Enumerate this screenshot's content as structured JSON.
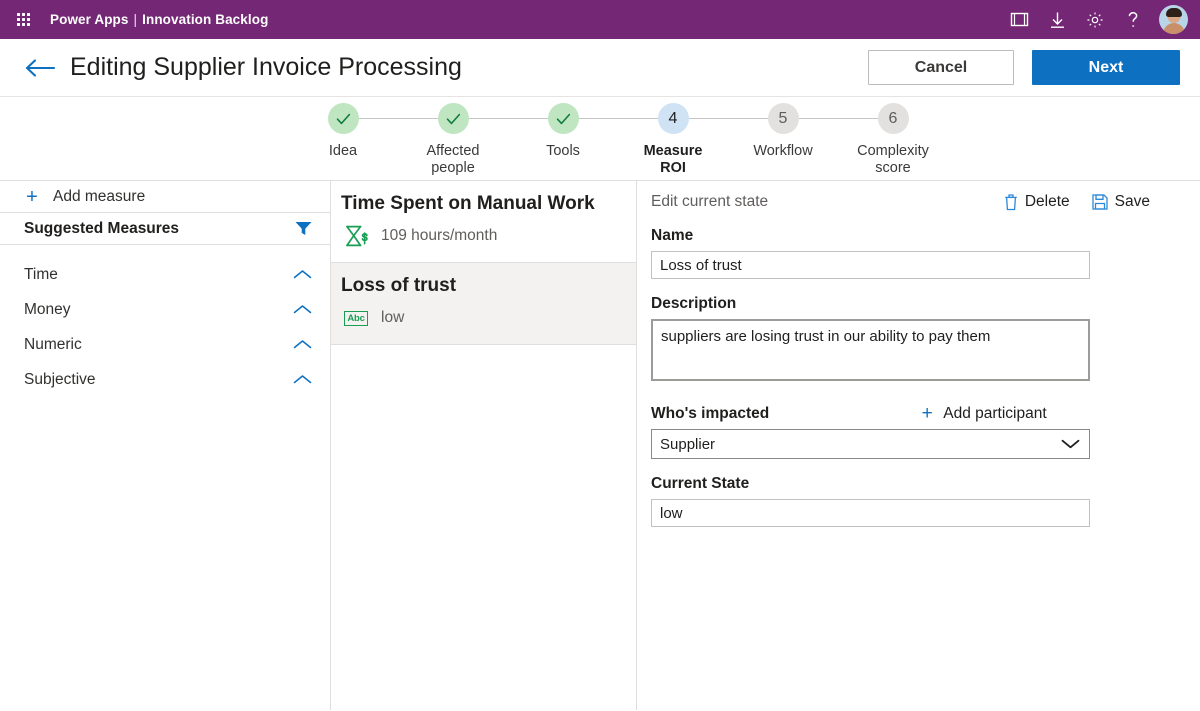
{
  "topbar": {
    "waffle_icon": "app-launcher-icon",
    "brand": "Power Apps",
    "separator": "|",
    "app_name": "Innovation Backlog",
    "icons": [
      {
        "name": "screen-frame-icon",
        "label": "Display options"
      },
      {
        "name": "download-icon",
        "label": "Download"
      },
      {
        "name": "gear-icon",
        "label": "Settings"
      },
      {
        "name": "help-icon",
        "label": "Help"
      }
    ],
    "avatar_name": "user-avatar"
  },
  "header": {
    "back_icon": "back-arrow-icon",
    "title": "Editing Supplier Invoice Processing",
    "cancel_label": "Cancel",
    "next_label": "Next",
    "accent_blue": "#0e70c0"
  },
  "stepper": {
    "steps": [
      {
        "number": "1",
        "label": "Idea",
        "state": "done",
        "mark": "✓"
      },
      {
        "number": "2",
        "label": "Affected\npeople",
        "state": "done",
        "mark": "✓"
      },
      {
        "number": "3",
        "label": "Tools",
        "state": "done",
        "mark": "✓"
      },
      {
        "number": "4",
        "label": "Measure\nROI",
        "state": "active",
        "mark": "4"
      },
      {
        "number": "5",
        "label": "Workflow",
        "state": "todo",
        "mark": "5"
      },
      {
        "number": "6",
        "label": "Complexity\nscore",
        "state": "todo",
        "mark": "6"
      }
    ],
    "done_color": "#bfe6c0",
    "active_color": "#cfe3f5",
    "todo_color": "#e3e1df"
  },
  "sidebar": {
    "add_measure_label": "Add measure",
    "suggested_title": "Suggested Measures",
    "filter_icon": "filter-icon",
    "categories": [
      {
        "label": "Time",
        "chevron": "chevron-up-icon"
      },
      {
        "label": "Money",
        "chevron": "chevron-up-icon"
      },
      {
        "label": "Numeric",
        "chevron": "chevron-up-icon"
      },
      {
        "label": "Subjective",
        "chevron": "chevron-up-icon"
      }
    ]
  },
  "measures": [
    {
      "name": "Time Spent on Manual Work",
      "icon": "hourglass-dollar-icon",
      "icon_type": "hourglass",
      "value": "109 hours/month",
      "selected": false
    },
    {
      "name": "Loss of trust",
      "icon": "abc-text-icon",
      "icon_type": "abc",
      "icon_text": "Abc",
      "value": "low",
      "selected": true
    }
  ],
  "detail": {
    "panel_title": "Edit current state",
    "delete_label": "Delete",
    "delete_icon": "trash-icon",
    "save_label": "Save",
    "save_icon": "save-disk-icon",
    "name_label": "Name",
    "name_value": "Loss of trust",
    "description_label": "Description",
    "description_value": "suppliers are losing trust in our ability to pay them",
    "whos_impacted_label": "Who's impacted",
    "add_participant_label": "Add participant",
    "participant_value": "Supplier",
    "participant_chevron": "chevron-down-icon",
    "current_state_label": "Current State",
    "current_state_value": "low"
  }
}
